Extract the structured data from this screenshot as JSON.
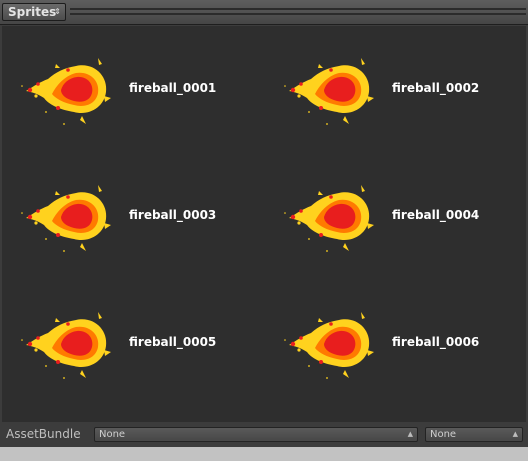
{
  "header": {
    "dropdown_label": "Sprites",
    "dropdown_arrow": "⇕"
  },
  "sprites": [
    {
      "name": "fireball_0001"
    },
    {
      "name": "fireball_0002"
    },
    {
      "name": "fireball_0003"
    },
    {
      "name": "fireball_0004"
    },
    {
      "name": "fireball_0005"
    },
    {
      "name": "fireball_0006"
    }
  ],
  "footer": {
    "label": "AssetBundle",
    "bundle_select": "None",
    "variant_select": "None"
  },
  "colors": {
    "panel_bg": "#3c3c3c",
    "grid_bg": "#2e2e2e",
    "flame_outer": "#ffd21e",
    "flame_mid": "#ff7a00",
    "flame_core": "#e81e1e",
    "tag_blue": "#3f76b6"
  },
  "icons": {
    "sprite_thumbnail": "fireball-icon",
    "tag": "tag-icon"
  }
}
